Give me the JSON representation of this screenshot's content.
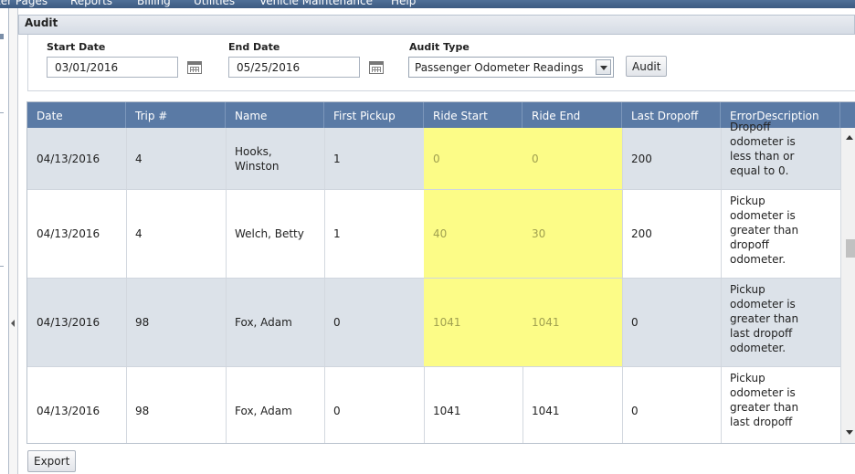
{
  "menu": {
    "items": [
      "ter Pages",
      "Reports",
      "Billing",
      "Utilities",
      "Vehicle Maintenance",
      "Help"
    ]
  },
  "panel": {
    "title": "Audit"
  },
  "filters": {
    "start_date_label": "Start Date",
    "start_date_value": "03/01/2016",
    "end_date_label": "End Date",
    "end_date_value": "05/25/2016",
    "audit_type_label": "Audit Type",
    "audit_type_value": "Passenger Odometer Readings",
    "audit_button": "Audit"
  },
  "table": {
    "columns": [
      "Date",
      "Trip #",
      "Name",
      "First Pickup",
      "Ride Start",
      "Ride End",
      "Last Dropoff",
      "ErrorDescription"
    ],
    "rows": [
      {
        "date": "04/13/2016",
        "trip": "4",
        "name": "Hooks, Winston",
        "first_pickup": "1",
        "ride_start": "0",
        "ride_end": "0",
        "last_dropoff": "200",
        "error": "Dropoff odometer is less than or equal to 0.",
        "highlight": true
      },
      {
        "date": "04/13/2016",
        "trip": "4",
        "name": "Welch, Betty",
        "first_pickup": "1",
        "ride_start": "40",
        "ride_end": "30",
        "last_dropoff": "200",
        "error": "Pickup odometer is greater than dropoff odometer.",
        "highlight": true
      },
      {
        "date": "04/13/2016",
        "trip": "98",
        "name": "Fox, Adam",
        "first_pickup": "0",
        "ride_start": "1041",
        "ride_end": "1041",
        "last_dropoff": "0",
        "error": "Pickup odometer is greater than last dropoff odometer.",
        "highlight": true
      },
      {
        "date": "04/13/2016",
        "trip": "98",
        "name": "Fox, Adam",
        "first_pickup": "0",
        "ride_start": "1041",
        "ride_end": "1041",
        "last_dropoff": "0",
        "error": "Pickup odometer is greater than last dropoff",
        "highlight": false
      }
    ]
  },
  "export_button": "Export",
  "colors": {
    "header_bg": "#5a7aa5",
    "highlight": "#fcfc87",
    "alt_row": "#dce2e9"
  }
}
